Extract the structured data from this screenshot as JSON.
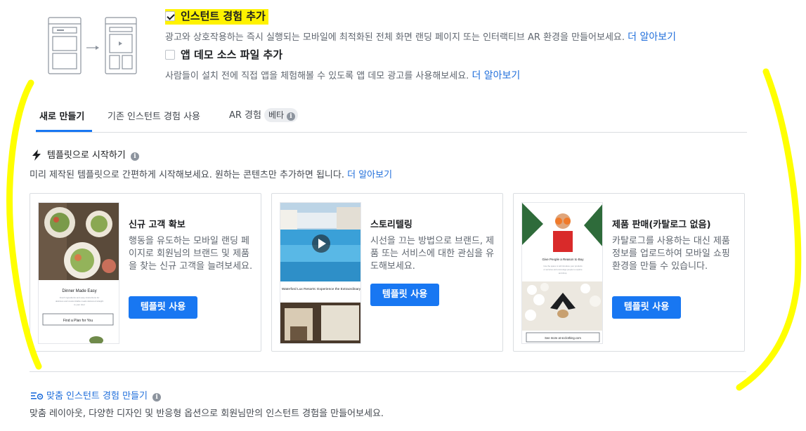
{
  "options": {
    "instant": {
      "checked": true,
      "label": "인스턴트 경험 추가",
      "desc": "광고와 상호작용하는 즉시 실행되는 모바일에 최적화된 전체 화면 랜딩 페이지 또는 인터랙티브 AR 환경을 만들어보세요.",
      "link": "더 알아보기"
    },
    "app_demo": {
      "checked": false,
      "label": "앱 데모 소스 파일 추가",
      "desc": "사람들이 설치 전에 직접 앱을 체험해볼 수 있도록 앱 데모 광고를 사용해보세요.",
      "link": "더 알아보기"
    }
  },
  "tabs": [
    {
      "label": "새로 만들기",
      "active": true
    },
    {
      "label": "기존 인스턴트 경험 사용",
      "active": false
    },
    {
      "label": "AR 경험",
      "badge": "베타",
      "active": false
    }
  ],
  "templates_section": {
    "title": "템플릿으로 시작하기",
    "desc": "미리 제작된 템플릿으로 간편하게 시작해보세요. 원하는 콘텐츠만 추가하면 됩니다.",
    "link": "더 알아보기"
  },
  "cards": [
    {
      "title": "신규 고객 확보",
      "desc": "행동을 유도하는 모바일 랜딩 페이지로 회원님의 브랜드 및 제품을 찾는 신규 고객을 늘려보세요.",
      "button": "템플릿 사용",
      "thumb_heading": "Dinner Made Easy",
      "thumb_body": "Fresh ingredients and easy instructions for delicious and customizable meals delivered straight to your door",
      "thumb_cta": "Find a Plan for You"
    },
    {
      "title": "스토리텔링",
      "desc": "시선을 끄는 방법으로 브랜드, 제품 또는 서비스에 대한 관심을 유도해보세요.",
      "button": "템플릿 사용",
      "thumb_heading": "Waterford Lux Resorts: Experience the Extraordinary"
    },
    {
      "title": "제품 판매(카탈로그 없음)",
      "desc": "카탈로그를 사용하는 대신 제품 정보를 업로드하여 모바일 쇼핑 환경을 만들 수 있습니다.",
      "button": "템플릿 사용",
      "thumb_heading": "Give People a Reason to Buy",
      "thumb_body": "Use the space to tell introduce your products or services and encourage people to explore and shop.",
      "thumb_cta": "See more at scclothing.com"
    }
  ],
  "custom_section": {
    "title": "맞춤 인스턴트 경험 만들기",
    "desc": "맞춤 레이아웃, 다양한 디자인 및 반응형 옵션으로 회원님만의 인스턴트 경험을 만들어보세요."
  },
  "colors": {
    "accent": "#1877f2",
    "link": "#216fdb",
    "highlight": "#fff200",
    "annotation": "#ffff00"
  }
}
